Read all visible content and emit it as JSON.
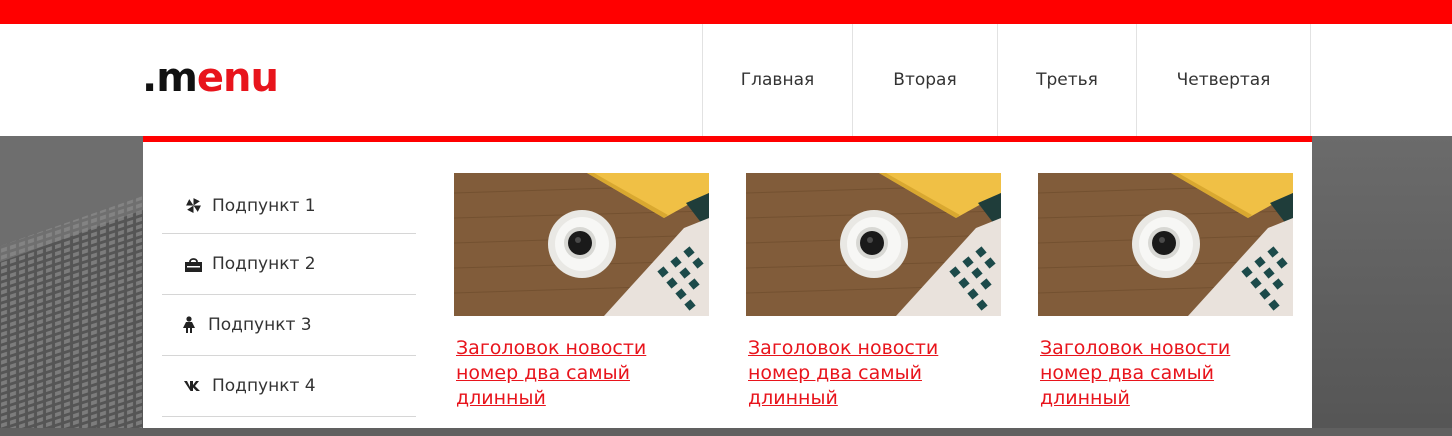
{
  "logo": {
    "dot": ".",
    "m": "m",
    "rest": "enu"
  },
  "nav": {
    "items": [
      {
        "label": "Главная"
      },
      {
        "label": "Вторая"
      },
      {
        "label": "Третья"
      },
      {
        "label": "Четвертая"
      }
    ]
  },
  "submenu": {
    "items": [
      {
        "label": "Подпункт 1",
        "icon": "pinwheel-icon"
      },
      {
        "label": "Подпункт 2",
        "icon": "shopping-bag-icon"
      },
      {
        "label": "Подпункт 3",
        "icon": "woman-icon"
      },
      {
        "label": "Подпункт 4",
        "icon": "vk-icon"
      }
    ]
  },
  "news": {
    "cards": [
      {
        "title": "Заголовок новости номер два самый длинный",
        "image": "coffee-laptop-desk-photo"
      },
      {
        "title": "Заголовок новости номер два самый длинный",
        "image": "coffee-laptop-desk-photo"
      },
      {
        "title": "Заголовок новости номер два самый длинный",
        "image": "coffee-laptop-desk-photo"
      }
    ]
  },
  "colors": {
    "accent": "#ff0000",
    "link": "#e8141c",
    "text": "#333333",
    "divider": "#d6d6d6"
  }
}
